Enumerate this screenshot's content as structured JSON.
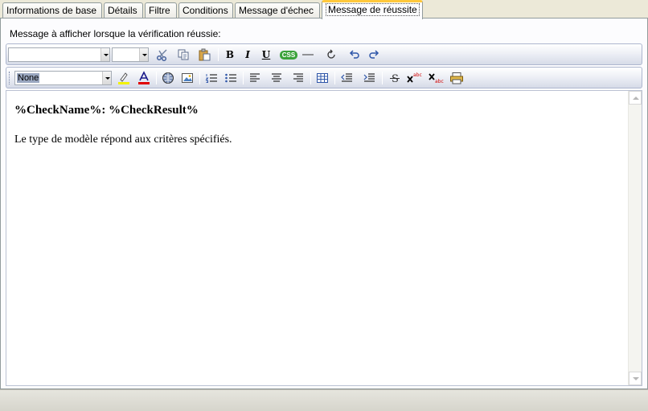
{
  "tabs": [
    {
      "label": "Informations de base",
      "active": false
    },
    {
      "label": "Détails",
      "active": false
    },
    {
      "label": "Filtre",
      "active": false
    },
    {
      "label": "Conditions",
      "active": false
    },
    {
      "label": "Message d'échec",
      "active": false
    },
    {
      "label": "Message de réussite",
      "active": true
    }
  ],
  "caption": "Message à afficher lorsque la vérification réussie:",
  "toolbar1": {
    "font_combo": "",
    "size_combo": "",
    "css_label": "CSS"
  },
  "toolbar2": {
    "style_combo": "None"
  },
  "editor": {
    "heading": "%CheckName%: %CheckResult%",
    "body": "Le type de modèle répond aux critères spécifiés."
  },
  "colors": {
    "active_tab_accent": "#ffc83c",
    "css_badge": "#3aa23a",
    "highlight_bar": "#f2f200",
    "font_color_bar": "#e00000"
  }
}
